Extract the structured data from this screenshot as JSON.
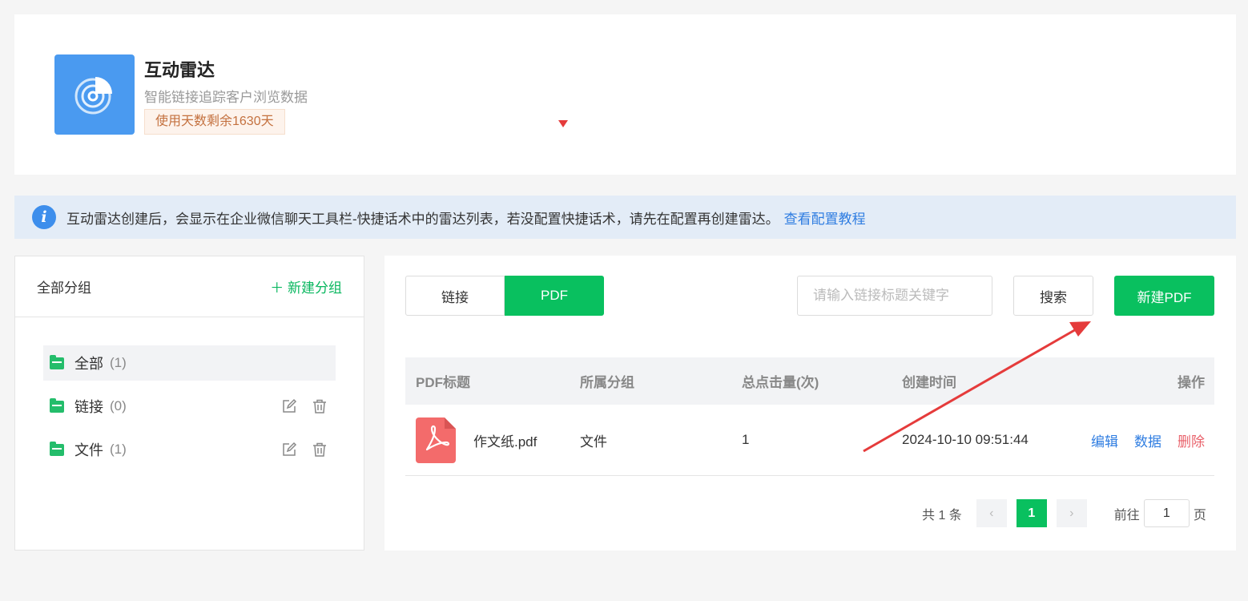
{
  "header": {
    "title": "互动雷达",
    "subtitle": "智能链接追踪客户浏览数据",
    "days_badge": "使用天数剩余1630天"
  },
  "notice": {
    "text": "互动雷达创建后，会显示在企业微信聊天工具栏-快捷话术中的雷达列表，若没配置快捷话术，请先在配置再创建雷达。",
    "link": "查看配置教程"
  },
  "groups": {
    "title": "全部分组",
    "new_label": "＋ 新建分组",
    "items": [
      {
        "name": "全部",
        "count": "(1)"
      },
      {
        "name": "链接",
        "count": "(0)"
      },
      {
        "name": "文件",
        "count": "(1)"
      }
    ]
  },
  "toolbar": {
    "tabs": [
      "链接",
      "PDF"
    ],
    "active_tab": "PDF",
    "search_placeholder": "请输入链接标题关键字",
    "search_label": "搜索",
    "new_label": "新建PDF"
  },
  "table": {
    "columns": [
      "PDF标题",
      "所属分组",
      "总点击量(次)",
      "创建时间",
      "操作"
    ],
    "rows": [
      {
        "title": "作文纸.pdf",
        "group": "文件",
        "clicks": "1",
        "created": "2024-10-10 09:51:44",
        "actions": [
          "编辑",
          "数据",
          "删除"
        ]
      }
    ]
  },
  "pagination": {
    "total": "共 1 条",
    "prev": "‹",
    "current": "1",
    "next": "›",
    "goto_label": "前往",
    "goto_value": "1",
    "page_suffix": "页"
  },
  "colors": {
    "accent": "#09c05f",
    "link": "#2f7de1",
    "danger": "#e9626b",
    "annotation": "#e53b3b"
  }
}
